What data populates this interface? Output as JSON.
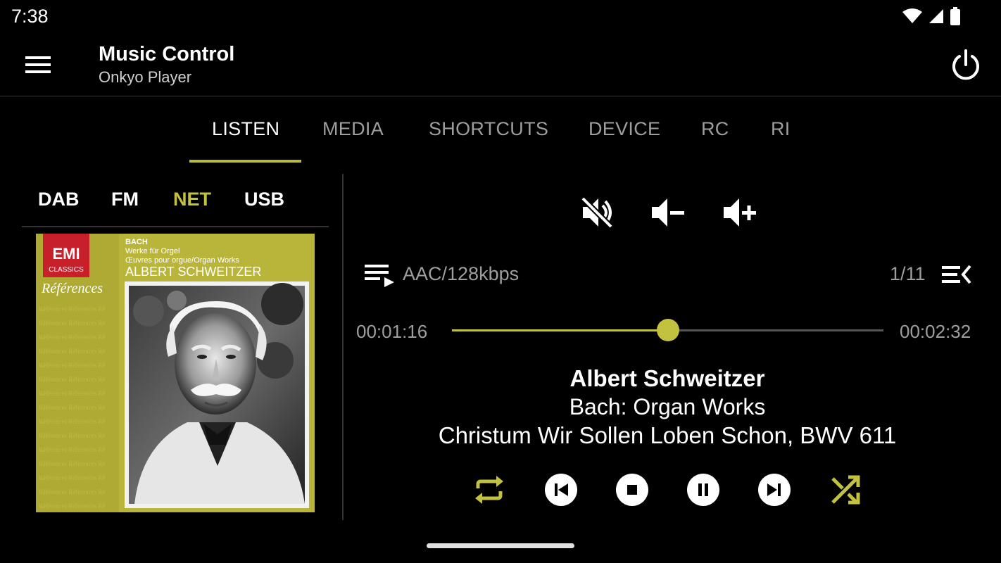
{
  "status_bar": {
    "time": "7:38",
    "icons": [
      "wifi-icon",
      "cellular-signal-icon",
      "battery-icon"
    ]
  },
  "app_bar": {
    "title": "Music Control",
    "subtitle": "Onkyo Player",
    "icons": [
      "menu-icon",
      "power-icon"
    ]
  },
  "tabs": [
    {
      "label": "LISTEN",
      "active": true
    },
    {
      "label": "MEDIA",
      "active": false
    },
    {
      "label": "SHORTCUTS",
      "active": false
    },
    {
      "label": "DEVICE",
      "active": false
    },
    {
      "label": "RC",
      "active": false
    },
    {
      "label": "RI",
      "active": false
    }
  ],
  "sources": [
    {
      "label": "DAB",
      "active": false
    },
    {
      "label": "FM",
      "active": false
    },
    {
      "label": "NET",
      "active": true
    },
    {
      "label": "USB",
      "active": false
    }
  ],
  "album_art": {
    "label_brand_line1": "EMI",
    "label_brand_line2": "CLASSICS",
    "series": "Références",
    "composer": "BACH",
    "work_de": "Werke für Orgel",
    "work_fr_en": "Œuvres pour orgue/Organ Works",
    "performer": "ALBERT SCHWEITZER"
  },
  "volume": {
    "icons": [
      "mute-icon",
      "volume-down-icon",
      "volume-up-icon"
    ]
  },
  "playback": {
    "format": "AAC/128kbps",
    "track_position": "1/11",
    "elapsed": "00:01:16",
    "total": "00:02:32",
    "progress": 0.5
  },
  "now_playing": {
    "artist": "Albert Schweitzer",
    "album": "Bach: Organ Works",
    "title": "Christum Wir Sollen Loben Schon, BWV 611"
  },
  "transport": {
    "icons": [
      "repeat-icon",
      "previous-icon",
      "stop-icon",
      "pause-icon",
      "next-icon",
      "shuffle-icon"
    ]
  },
  "colors": {
    "accent": "#c2c140",
    "background": "#000000",
    "text_primary": "#ffffff",
    "text_secondary": "#9e9e9e",
    "album_cover_olive": "#b9b53a",
    "emi_red": "#c8202a"
  }
}
